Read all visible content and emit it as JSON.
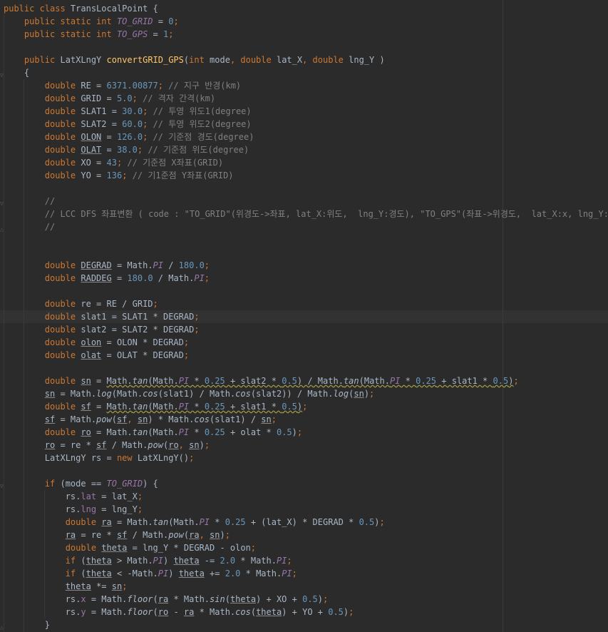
{
  "editor": {
    "language": "java",
    "colors": {
      "background": "#2b2b2b",
      "default": "#a9b7c6",
      "keyword": "#cc7832",
      "number": "#6897bb",
      "comment": "#808080",
      "string": "#6a8759",
      "field": "#9876aa",
      "method_declaration": "#ffc66d",
      "warning_underline": "#a39c46"
    },
    "lines": [
      [
        [
          "kw",
          "public class "
        ],
        [
          "",
          "TransLocalPoint {"
        ]
      ],
      [
        [
          "",
          "    "
        ],
        [
          "kw",
          "public static int "
        ],
        [
          "sfi",
          "TO_GRID"
        ],
        [
          "",
          " = "
        ],
        [
          "num",
          "0"
        ],
        [
          "kw",
          ";"
        ]
      ],
      [
        [
          "",
          "    "
        ],
        [
          "kw",
          "public static int "
        ],
        [
          "sfi",
          "TO_GPS"
        ],
        [
          "",
          " = "
        ],
        [
          "num",
          "1"
        ],
        [
          "kw",
          ";"
        ]
      ],
      [
        [
          "",
          ""
        ]
      ],
      [
        [
          "",
          "    "
        ],
        [
          "kw",
          "public "
        ],
        [
          "",
          "LatXLngY "
        ],
        [
          "fn",
          "convertGRID_GPS"
        ],
        [
          "",
          "("
        ],
        [
          "kw",
          "int "
        ],
        [
          "",
          "mode"
        ],
        [
          "kw",
          ", double "
        ],
        [
          "",
          "lat_X"
        ],
        [
          "kw",
          ", double "
        ],
        [
          "",
          "lng_Y )"
        ]
      ],
      [
        [
          "",
          "    {"
        ]
      ],
      [
        [
          "",
          "        "
        ],
        [
          "kw",
          "double "
        ],
        [
          "",
          "RE = "
        ],
        [
          "num",
          "6371.00877"
        ],
        [
          "kw",
          "; "
        ],
        [
          "cmt",
          "// 지구 반경(km)"
        ]
      ],
      [
        [
          "",
          "        "
        ],
        [
          "kw",
          "double "
        ],
        [
          "",
          "GRID = "
        ],
        [
          "num",
          "5.0"
        ],
        [
          "kw",
          "; "
        ],
        [
          "cmt",
          "// 격자 간격(km)"
        ]
      ],
      [
        [
          "",
          "        "
        ],
        [
          "kw",
          "double "
        ],
        [
          "",
          "SLAT1 = "
        ],
        [
          "num",
          "30.0"
        ],
        [
          "kw",
          "; "
        ],
        [
          "cmt",
          "// 투영 위도1(degree)"
        ]
      ],
      [
        [
          "",
          "        "
        ],
        [
          "kw",
          "double "
        ],
        [
          "",
          "SLAT2 = "
        ],
        [
          "num",
          "60.0"
        ],
        [
          "kw",
          "; "
        ],
        [
          "cmt",
          "// 투영 위도2(degree)"
        ]
      ],
      [
        [
          "",
          "        "
        ],
        [
          "kw",
          "double "
        ],
        [
          "ul",
          "OLON"
        ],
        [
          "",
          " = "
        ],
        [
          "num",
          "126.0"
        ],
        [
          "kw",
          "; "
        ],
        [
          "cmt",
          "// 기준점 경도(degree)"
        ]
      ],
      [
        [
          "",
          "        "
        ],
        [
          "kw",
          "double "
        ],
        [
          "ul",
          "OLAT"
        ],
        [
          "",
          " = "
        ],
        [
          "num",
          "38.0"
        ],
        [
          "kw",
          "; "
        ],
        [
          "cmt",
          "// 기준점 위도(degree)"
        ]
      ],
      [
        [
          "",
          "        "
        ],
        [
          "kw",
          "double "
        ],
        [
          "",
          "XO = "
        ],
        [
          "num",
          "43"
        ],
        [
          "kw",
          "; "
        ],
        [
          "cmt",
          "// 기준점 X좌표(GRID)"
        ]
      ],
      [
        [
          "",
          "        "
        ],
        [
          "kw",
          "double "
        ],
        [
          "",
          "YO = "
        ],
        [
          "num",
          "136"
        ],
        [
          "kw",
          "; "
        ],
        [
          "cmt",
          "// 기1준점 Y좌표(GRID)"
        ]
      ],
      [
        [
          "",
          ""
        ]
      ],
      [
        [
          "",
          "        "
        ],
        [
          "cmt",
          "//"
        ]
      ],
      [
        [
          "",
          "        "
        ],
        [
          "cmt",
          "// LCC DFS 좌표변환 ( code : \"TO_GRID\"(위경도->좌표, lat_X:위도,  lng_Y:경도), \"TO_GPS\"(좌표->위경도,  lat_X:x, lng_Y:y) )"
        ]
      ],
      [
        [
          "",
          "        "
        ],
        [
          "cmt",
          "//"
        ]
      ],
      [
        [
          "",
          ""
        ]
      ],
      [
        [
          "",
          ""
        ]
      ],
      [
        [
          "",
          "        "
        ],
        [
          "kw",
          "double "
        ],
        [
          "ul",
          "DEGRAD"
        ],
        [
          "",
          " = Math."
        ],
        [
          "sfi",
          "PI"
        ],
        [
          "",
          " / "
        ],
        [
          "num",
          "180.0"
        ],
        [
          "kw",
          ";"
        ]
      ],
      [
        [
          "",
          "        "
        ],
        [
          "kw",
          "double "
        ],
        [
          "ul",
          "RADDEG"
        ],
        [
          "",
          " = "
        ],
        [
          "num",
          "180.0"
        ],
        [
          "",
          " / Math."
        ],
        [
          "sfi",
          "PI"
        ],
        [
          "kw",
          ";"
        ]
      ],
      [
        [
          "",
          ""
        ]
      ],
      [
        [
          "",
          "        "
        ],
        [
          "kw",
          "double "
        ],
        [
          "",
          "re = RE / GRID"
        ],
        [
          "kw",
          ";"
        ]
      ],
      [
        [
          "",
          "        "
        ],
        [
          "kw",
          "double "
        ],
        [
          "",
          "slat1 = SLAT1 * DEGRAD"
        ],
        [
          "kw",
          ";"
        ]
      ],
      [
        [
          "",
          "        "
        ],
        [
          "kw",
          "double "
        ],
        [
          "",
          "slat2 = SLAT2 * DEGRAD"
        ],
        [
          "kw",
          ";"
        ]
      ],
      [
        [
          "",
          "        "
        ],
        [
          "kw",
          "double "
        ],
        [
          "ul",
          "olon"
        ],
        [
          "",
          " = OLON * DEGRAD"
        ],
        [
          "kw",
          ";"
        ]
      ],
      [
        [
          "",
          "        "
        ],
        [
          "kw",
          "double "
        ],
        [
          "ul",
          "olat"
        ],
        [
          "",
          " = OLAT * DEGRAD"
        ],
        [
          "kw",
          ";"
        ]
      ],
      [
        [
          "",
          ""
        ]
      ],
      [
        [
          "",
          "        "
        ],
        [
          "kw",
          "double "
        ],
        [
          "ul",
          "sn"
        ],
        [
          "",
          " = "
        ],
        [
          "wv",
          "Math."
        ],
        [
          "wv si",
          "tan"
        ],
        [
          "wv",
          "(Math."
        ],
        [
          "wv sfi",
          "PI"
        ],
        [
          "wv",
          " * "
        ],
        [
          "wv num",
          "0.25"
        ],
        [
          "wv",
          " + slat2 * "
        ],
        [
          "wv num",
          "0.5"
        ],
        [
          "wv",
          ") / Math."
        ],
        [
          "wv si",
          "tan"
        ],
        [
          "wv",
          "(Math."
        ],
        [
          "wv sfi",
          "PI"
        ],
        [
          "wv",
          " * "
        ],
        [
          "wv num",
          "0.25"
        ],
        [
          "wv",
          " + slat1 * "
        ],
        [
          "wv num",
          "0.5"
        ],
        [
          "wv",
          ")"
        ],
        [
          "kw",
          ";"
        ]
      ],
      [
        [
          "",
          "        "
        ],
        [
          "ul",
          "sn"
        ],
        [
          "",
          " = Math."
        ],
        [
          "si",
          "log"
        ],
        [
          "",
          "(Math."
        ],
        [
          "si",
          "cos"
        ],
        [
          "",
          "(slat1) / Math."
        ],
        [
          "si",
          "cos"
        ],
        [
          "",
          "(slat2)) / Math."
        ],
        [
          "si",
          "log"
        ],
        [
          "",
          "("
        ],
        [
          "ul",
          "sn"
        ],
        [
          "",
          ")"
        ],
        [
          "kw",
          ";"
        ]
      ],
      [
        [
          "",
          "        "
        ],
        [
          "kw",
          "double "
        ],
        [
          "ul",
          "sf"
        ],
        [
          "",
          " = "
        ],
        [
          "wv",
          "Math."
        ],
        [
          "wv si",
          "tan"
        ],
        [
          "wv",
          "(Math."
        ],
        [
          "wv sfi",
          "PI"
        ],
        [
          "wv",
          " * "
        ],
        [
          "wv num",
          "0.25"
        ],
        [
          "wv",
          " + slat1 * "
        ],
        [
          "wv num",
          "0.5"
        ],
        [
          "wv",
          ")"
        ],
        [
          "kw",
          ";"
        ]
      ],
      [
        [
          "",
          "        "
        ],
        [
          "ul",
          "sf"
        ],
        [
          "",
          " = Math."
        ],
        [
          "si",
          "pow"
        ],
        [
          "",
          "("
        ],
        [
          "ul",
          "sf"
        ],
        [
          "kw",
          ", "
        ],
        [
          "ul",
          "sn"
        ],
        [
          "",
          ") * Math."
        ],
        [
          "si",
          "cos"
        ],
        [
          "",
          "(slat1) / "
        ],
        [
          "ul",
          "sn"
        ],
        [
          "kw",
          ";"
        ]
      ],
      [
        [
          "",
          "        "
        ],
        [
          "kw",
          "double "
        ],
        [
          "ul",
          "ro"
        ],
        [
          "",
          " = Math."
        ],
        [
          "si",
          "tan"
        ],
        [
          "",
          "(Math."
        ],
        [
          "sfi",
          "PI"
        ],
        [
          "",
          " * "
        ],
        [
          "num",
          "0.25"
        ],
        [
          "",
          " + olat * "
        ],
        [
          "num",
          "0.5"
        ],
        [
          "",
          ")"
        ],
        [
          "kw",
          ";"
        ]
      ],
      [
        [
          "",
          "        "
        ],
        [
          "ul",
          "ro"
        ],
        [
          "",
          " = re * "
        ],
        [
          "ul",
          "sf"
        ],
        [
          "",
          " / Math."
        ],
        [
          "si",
          "pow"
        ],
        [
          "",
          "("
        ],
        [
          "ul",
          "ro"
        ],
        [
          "kw",
          ", "
        ],
        [
          "ul",
          "sn"
        ],
        [
          "",
          ")"
        ],
        [
          "kw",
          ";"
        ]
      ],
      [
        [
          "",
          "        LatXLngY rs = "
        ],
        [
          "kw",
          "new "
        ],
        [
          "",
          "LatXLngY()"
        ],
        [
          "kw",
          ";"
        ]
      ],
      [
        [
          "",
          ""
        ]
      ],
      [
        [
          "",
          "        "
        ],
        [
          "kw",
          "if "
        ],
        [
          "",
          "(mode == "
        ],
        [
          "sfi",
          "TO_GRID"
        ],
        [
          "",
          ") {"
        ]
      ],
      [
        [
          "",
          "            rs."
        ],
        [
          "fld",
          "lat"
        ],
        [
          "",
          " = lat_X"
        ],
        [
          "kw",
          ";"
        ]
      ],
      [
        [
          "",
          "            rs."
        ],
        [
          "fld",
          "lng"
        ],
        [
          "",
          " = lng_Y"
        ],
        [
          "kw",
          ";"
        ]
      ],
      [
        [
          "",
          "            "
        ],
        [
          "kw",
          "double "
        ],
        [
          "ul",
          "ra"
        ],
        [
          "",
          " = Math."
        ],
        [
          "si",
          "tan"
        ],
        [
          "",
          "(Math."
        ],
        [
          "sfi",
          "PI"
        ],
        [
          "",
          " * "
        ],
        [
          "num",
          "0.25"
        ],
        [
          "",
          " + (lat_X) * DEGRAD * "
        ],
        [
          "num",
          "0.5"
        ],
        [
          "",
          ")"
        ],
        [
          "kw",
          ";"
        ]
      ],
      [
        [
          "",
          "            "
        ],
        [
          "ul",
          "ra"
        ],
        [
          "",
          " = re * "
        ],
        [
          "ul",
          "sf"
        ],
        [
          "",
          " / Math."
        ],
        [
          "si",
          "pow"
        ],
        [
          "",
          "("
        ],
        [
          "ul",
          "ra"
        ],
        [
          "kw",
          ", "
        ],
        [
          "ul",
          "sn"
        ],
        [
          "",
          ")"
        ],
        [
          "kw",
          ";"
        ]
      ],
      [
        [
          "",
          "            "
        ],
        [
          "kw",
          "double "
        ],
        [
          "ul",
          "theta"
        ],
        [
          "",
          " = lng_Y * DEGRAD - olon"
        ],
        [
          "kw",
          ";"
        ]
      ],
      [
        [
          "",
          "            "
        ],
        [
          "kw",
          "if "
        ],
        [
          "",
          "("
        ],
        [
          "ul",
          "theta"
        ],
        [
          "",
          " > Math."
        ],
        [
          "sfi",
          "PI"
        ],
        [
          "",
          ") "
        ],
        [
          "ul",
          "theta"
        ],
        [
          "",
          " -= "
        ],
        [
          "num",
          "2.0"
        ],
        [
          "",
          " * Math."
        ],
        [
          "sfi",
          "PI"
        ],
        [
          "kw",
          ";"
        ]
      ],
      [
        [
          "",
          "            "
        ],
        [
          "kw",
          "if "
        ],
        [
          "",
          "("
        ],
        [
          "ul",
          "theta"
        ],
        [
          "",
          " < -Math."
        ],
        [
          "sfi",
          "PI"
        ],
        [
          "",
          ") "
        ],
        [
          "ul",
          "theta"
        ],
        [
          "",
          " += "
        ],
        [
          "num",
          "2.0"
        ],
        [
          "",
          " * Math."
        ],
        [
          "sfi",
          "PI"
        ],
        [
          "kw",
          ";"
        ]
      ],
      [
        [
          "",
          "            "
        ],
        [
          "ul",
          "theta"
        ],
        [
          "",
          " *= "
        ],
        [
          "ul",
          "sn"
        ],
        [
          "kw",
          ";"
        ]
      ],
      [
        [
          "",
          "            rs."
        ],
        [
          "fld",
          "x"
        ],
        [
          "",
          " = Math."
        ],
        [
          "si",
          "floor"
        ],
        [
          "",
          "("
        ],
        [
          "ul",
          "ra"
        ],
        [
          "",
          " * Math."
        ],
        [
          "si",
          "sin"
        ],
        [
          "",
          "("
        ],
        [
          "ul",
          "theta"
        ],
        [
          "",
          ") + XO + "
        ],
        [
          "num",
          "0.5"
        ],
        [
          "",
          ")"
        ],
        [
          "kw",
          ";"
        ]
      ],
      [
        [
          "",
          "            rs."
        ],
        [
          "fld",
          "y"
        ],
        [
          "",
          " = Math."
        ],
        [
          "si",
          "floor"
        ],
        [
          "",
          "("
        ],
        [
          "ul",
          "ro"
        ],
        [
          "",
          " - "
        ],
        [
          "ul",
          "ra"
        ],
        [
          "",
          " * Math."
        ],
        [
          "si",
          "cos"
        ],
        [
          "",
          "("
        ],
        [
          "ul",
          "theta"
        ],
        [
          "",
          ") + YO + "
        ],
        [
          "num",
          "0.5"
        ],
        [
          "",
          ")"
        ],
        [
          "kw",
          ";"
        ]
      ],
      [
        [
          "",
          "        }"
        ]
      ]
    ]
  }
}
